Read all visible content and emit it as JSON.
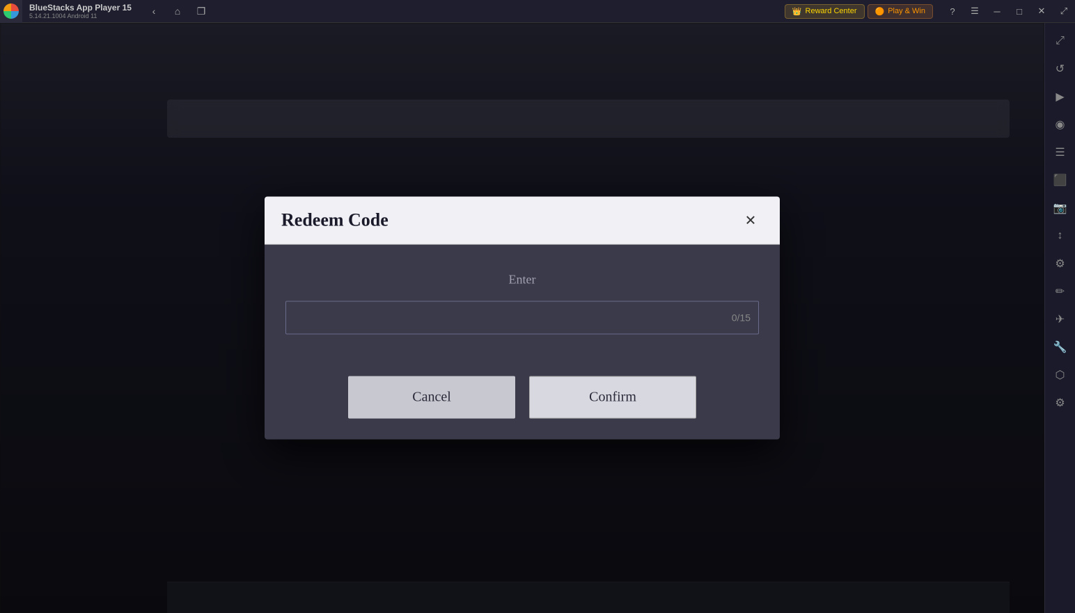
{
  "titlebar": {
    "app_name": "BlueStacks App Player 15",
    "version": "5.14.21.1004  Android 11",
    "reward_center_label": "Reward Center",
    "play_win_label": "Play & Win"
  },
  "nav_buttons": {
    "back": "‹",
    "home": "⌂",
    "copy": "❐"
  },
  "win_controls": {
    "help": "?",
    "menu": "☰",
    "minimize": "─",
    "maximize": "□",
    "close": "✕",
    "expand": "⤢"
  },
  "sidebar": {
    "icons": [
      "⤢",
      "↺",
      "▶",
      "◎",
      "☰",
      "⬛",
      "📷",
      "↕",
      "⚙",
      "✏",
      "✈",
      "🔧",
      "⬡",
      "⚙"
    ]
  },
  "modal": {
    "title": "Redeem Code",
    "close_label": "✕",
    "enter_label": "Enter",
    "input_placeholder": "",
    "input_counter": "0/15",
    "cancel_label": "Cancel",
    "confirm_label": "Confirm"
  }
}
